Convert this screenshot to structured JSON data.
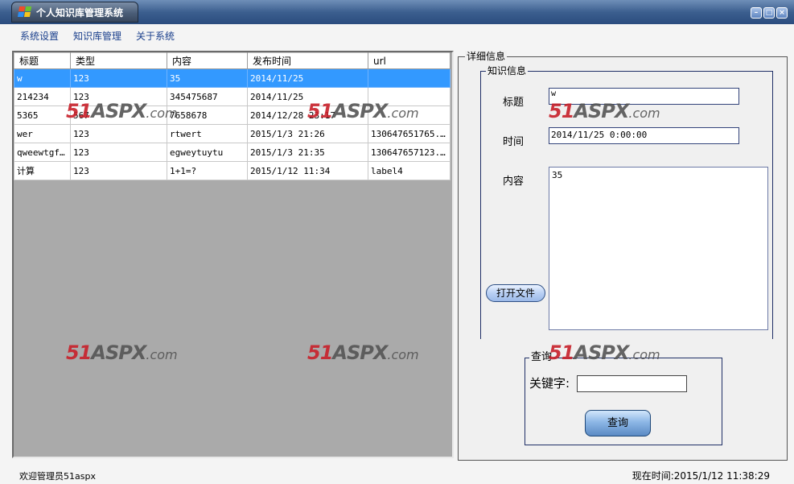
{
  "window": {
    "title": "个人知识库管理系统",
    "controls": [
      "minimize",
      "maximize",
      "close"
    ]
  },
  "menu": {
    "items": [
      "系统设置",
      "知识库管理",
      "关于系统"
    ]
  },
  "grid": {
    "columns": [
      "标题",
      "类型",
      "内容",
      "发布时间",
      "url"
    ],
    "rows": [
      [
        "w",
        "123",
        "35",
        "2014/11/25",
        ""
      ],
      [
        "214234",
        "123",
        "345475687",
        "2014/11/25",
        ""
      ],
      [
        "5365",
        "567",
        "7658678",
        "2014/12/28 23:17",
        ""
      ],
      [
        "wer",
        "123",
        "rtwert",
        "2015/1/3 21:26",
        "130647651765..."
      ],
      [
        "qweewtgfds",
        "123",
        "egweytuytu",
        "2015/1/3 21:35",
        "130647657123..."
      ],
      [
        "计算",
        "123",
        "1+1=?",
        "2015/1/12 11:34",
        "label4"
      ]
    ],
    "selected_row": 0
  },
  "detail": {
    "group_title": "详细信息",
    "info_title": "知识信息",
    "title_label": "标题",
    "title_value": "w",
    "time_label": "时间",
    "time_value": "2014/11/25 0:00:00",
    "content_label": "内容",
    "content_value": "35",
    "open_file_button": "打开文件"
  },
  "query": {
    "group_title": "查询",
    "keyword_label": "关键字:",
    "keyword_value": "",
    "query_button": "查询"
  },
  "status": {
    "welcome": "欢迎管理员51aspx",
    "current_time": "现在时间:2015/1/12 11:38:29"
  },
  "watermark": {
    "num": "51",
    "brand": "ASPX",
    "suffix": ".com"
  },
  "colors": {
    "selection": "#3399ff",
    "titlebar": "#3c5f8f",
    "menu_text": "#1a3f8c"
  }
}
